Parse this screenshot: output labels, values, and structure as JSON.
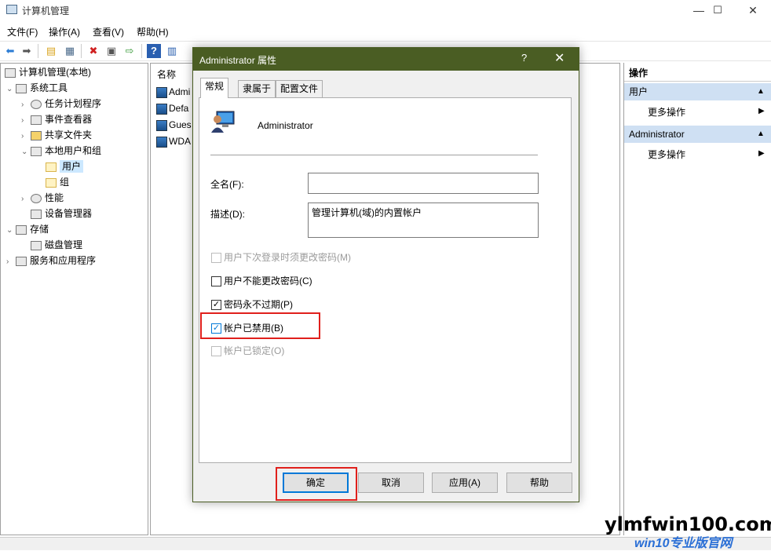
{
  "window": {
    "title": "计算机管理",
    "minimize": "—",
    "maximize": "☐",
    "close": "✕"
  },
  "menu": [
    "文件(F)",
    "操作(A)",
    "查看(V)",
    "帮助(H)"
  ],
  "tree": [
    {
      "label": "计算机管理(本地)",
      "exp": ""
    },
    {
      "label": "系统工具",
      "exp": "⌄"
    },
    {
      "label": "任务计划程序",
      "exp": "›"
    },
    {
      "label": "事件查看器",
      "exp": "›"
    },
    {
      "label": "共享文件夹",
      "exp": "›"
    },
    {
      "label": "本地用户和组",
      "exp": "⌄"
    },
    {
      "label": "用户",
      "exp": ""
    },
    {
      "label": "组",
      "exp": ""
    },
    {
      "label": "性能",
      "exp": "›"
    },
    {
      "label": "设备管理器",
      "exp": ""
    },
    {
      "label": "存储",
      "exp": "⌄"
    },
    {
      "label": "磁盘管理",
      "exp": ""
    },
    {
      "label": "服务和应用程序",
      "exp": "›"
    }
  ],
  "list": {
    "header": "名称",
    "rows": [
      "Admi",
      "Defa",
      "Gues",
      "WDA"
    ]
  },
  "actions": {
    "header": "操作",
    "groups": [
      {
        "title": "用户",
        "item": "更多操作"
      },
      {
        "title": "Administrator",
        "item": "更多操作"
      }
    ]
  },
  "dialog": {
    "title": "Administrator 属性",
    "help": "?",
    "close": "✕",
    "tabs": [
      "常规",
      "隶属于",
      "配置文件"
    ],
    "username": "Administrator",
    "fullname_label": "全名(F):",
    "fullname_value": "",
    "desc_label": "描述(D):",
    "desc_value": "管理计算机(域)的内置帐户",
    "checkboxes": [
      {
        "label": "用户下次登录时须更改密码(M)",
        "checked": false,
        "disabled": true
      },
      {
        "label": "用户不能更改密码(C)",
        "checked": false,
        "disabled": false
      },
      {
        "label": "密码永不过期(P)",
        "checked": true,
        "disabled": false
      },
      {
        "label": "帐户已禁用(B)",
        "checked": true,
        "disabled": false
      },
      {
        "label": "帐户已锁定(O)",
        "checked": false,
        "disabled": true
      }
    ],
    "buttons": [
      "确定",
      "取消",
      "应用(A)",
      "帮助"
    ]
  },
  "watermark": {
    "main": "ylmfwin100.com",
    "sub": "win10专业版官网"
  },
  "colors": {
    "dialog_title": "#4a5d23",
    "highlight": "#e0201c",
    "action_group_bg": "#cfe0f3"
  }
}
